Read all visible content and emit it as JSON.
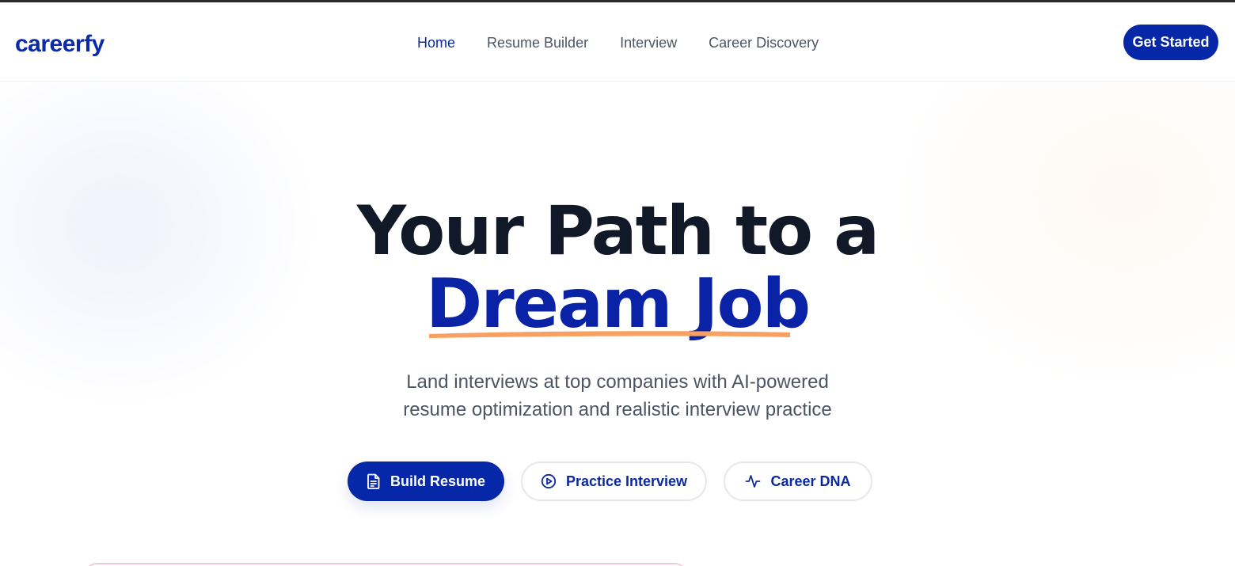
{
  "nav": {
    "logo": "careerfy",
    "links": [
      "Home",
      "Resume Builder",
      "Interview",
      "Career Discovery"
    ],
    "active": "Home",
    "cta_label": "Get Started"
  },
  "hero": {
    "headline_line1": "Your Path to a",
    "headline_line2": "Dream Job",
    "subtitle_line1": "Land interviews at top companies with AI-powered",
    "subtitle_line2": "resume optimization and realistic interview practice",
    "buttons": [
      {
        "label": "Build Resume",
        "icon": "file-text-icon"
      },
      {
        "label": "Practice Interview",
        "icon": "play-circle-icon"
      },
      {
        "label": "Career DNA",
        "icon": "activity-icon"
      }
    ]
  },
  "colors": {
    "brand": "#0628a8",
    "headline": "#111827",
    "accent_underline": "#f9a060",
    "body_text": "#4b5563"
  }
}
